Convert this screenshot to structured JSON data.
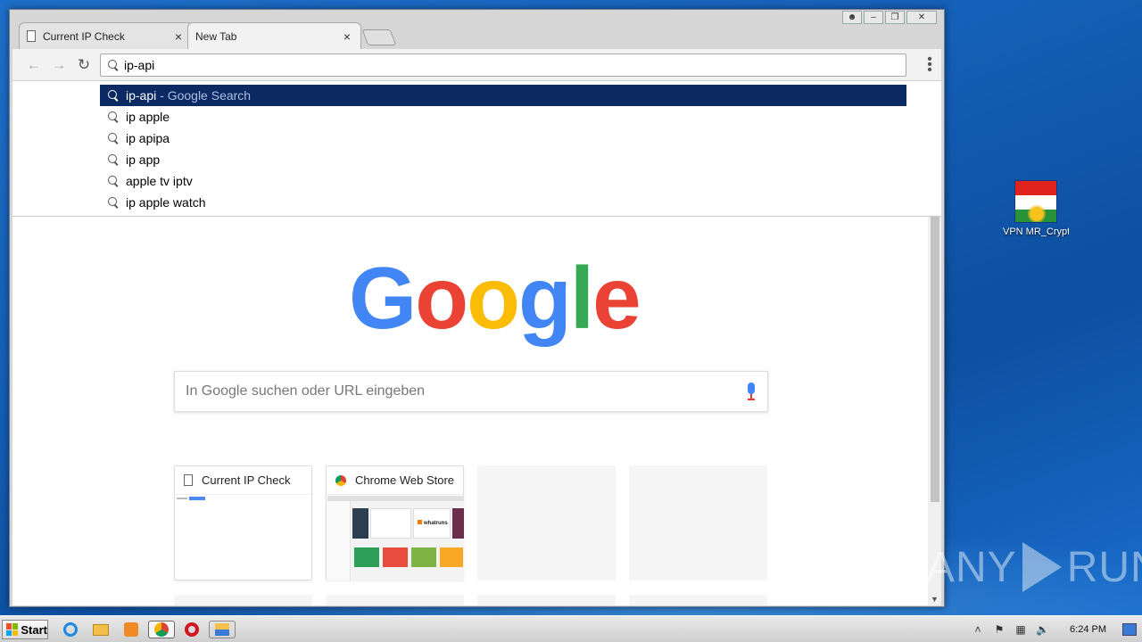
{
  "desktop": {
    "icon_label": "VPN MR_Crypte...",
    "flag_colors": {
      "top": "#e0231d",
      "middle": "#ffffff",
      "bottom": "#27923a",
      "sun": "#f6c21b"
    }
  },
  "browser": {
    "tabs": [
      {
        "title": "Current IP Check",
        "close": "×"
      },
      {
        "title": "New Tab",
        "close": "×"
      }
    ],
    "window_controls": {
      "minimize": "–",
      "restore": "❐",
      "close": "✕"
    },
    "address_value": "ip-api",
    "suggestions": [
      {
        "text": "ip-api",
        "hint": " - Google Search"
      },
      {
        "text": "ip apple"
      },
      {
        "text": "ip apipa"
      },
      {
        "text": "ip app"
      },
      {
        "text": "apple tv iptv"
      },
      {
        "text": "ip apple watch"
      }
    ],
    "selection_color": "#0b2a63"
  },
  "newtab": {
    "logo_letters": [
      "G",
      "o",
      "o",
      "g",
      "l",
      "e"
    ],
    "logo_colors": [
      "#4285f4",
      "#ea4335",
      "#fbbc05",
      "#4285f4",
      "#34a853",
      "#ea4335"
    ],
    "search_placeholder": "In Google suchen oder URL eingeben",
    "tiles": [
      {
        "title": "Current IP Check"
      },
      {
        "title": "Chrome Web Store"
      }
    ],
    "thumb_brand": "whatruns"
  },
  "watermark": {
    "left": "ANY",
    "right": "RUN"
  },
  "taskbar": {
    "start_label": "Start",
    "clock": "6:24 PM"
  }
}
